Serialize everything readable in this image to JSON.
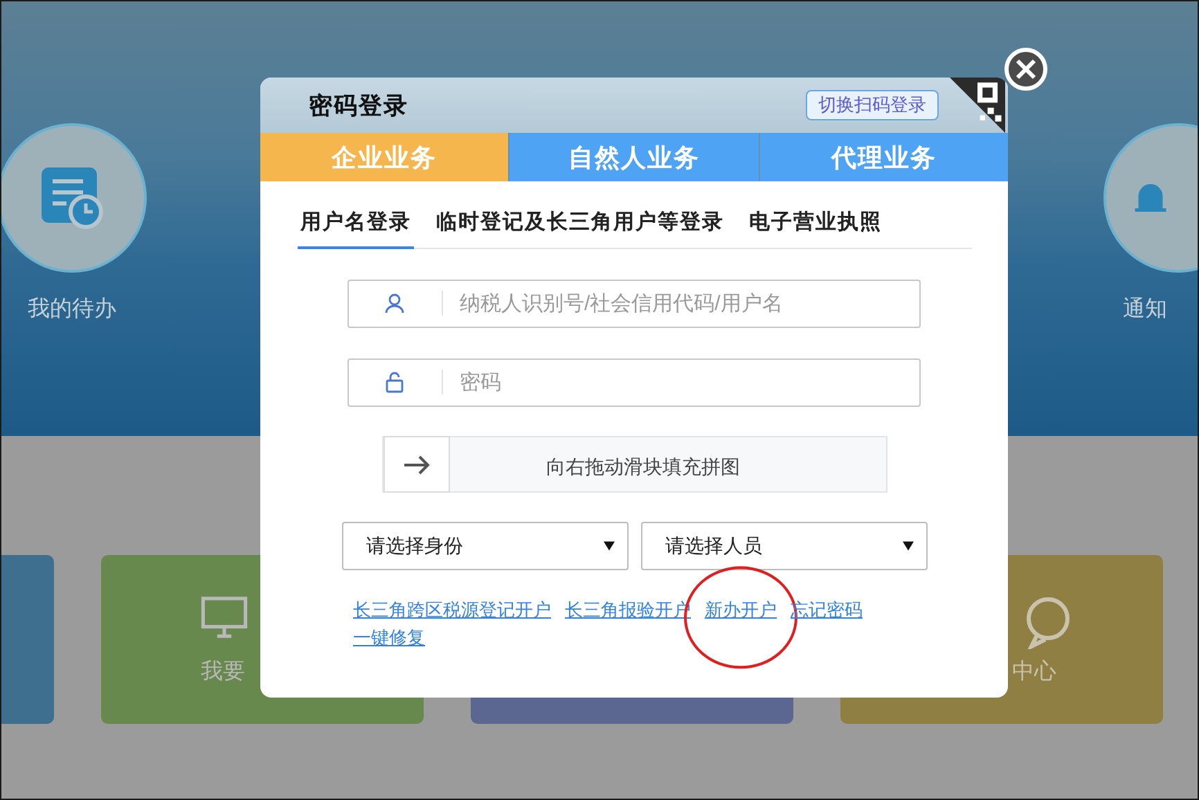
{
  "background": {
    "shortcuts": [
      {
        "label": "我的待办",
        "kind": "todo"
      },
      {
        "label": "通知",
        "kind": "bell"
      }
    ],
    "tiles": [
      {
        "color": "#3f6f8e"
      },
      {
        "color": "#67894d",
        "kind": "monitor",
        "label": "我要"
      },
      {
        "color": "#5b6791"
      },
      {
        "color": "#907f42",
        "kind": "chat",
        "label": "中心"
      }
    ]
  },
  "dialog": {
    "title": "密码登录",
    "switch_button": "切换扫码登录",
    "category_tabs": [
      {
        "label": "企业业务",
        "selected": true
      },
      {
        "label": "自然人业务",
        "selected": false
      },
      {
        "label": "代理业务",
        "selected": false
      }
    ],
    "login_tabs": [
      {
        "label": "用户名登录",
        "selected": true
      },
      {
        "label": "临时登记及长三角用户等登录",
        "selected": false
      },
      {
        "label": "电子营业执照",
        "selected": false
      }
    ],
    "fields": [
      {
        "kind": "user",
        "placeholder": "纳税人识别号/社会信用代码/用户名"
      },
      {
        "kind": "lock",
        "placeholder": "密码"
      }
    ],
    "slider": {
      "label": "向右拖动滑块填充拼图",
      "level": 0
    },
    "selects": [
      {
        "value": "请选择身份"
      },
      {
        "value": "请选择人员"
      }
    ],
    "links": [
      {
        "label": "长三角跨区税源登记开户",
        "circled": false
      },
      {
        "label": "长三角报验开户",
        "circled": false
      },
      {
        "label": "新办开户",
        "circled": true
      },
      {
        "label": "忘记密码",
        "circled": false
      },
      {
        "label": "一键修复",
        "circled": false
      }
    ]
  }
}
